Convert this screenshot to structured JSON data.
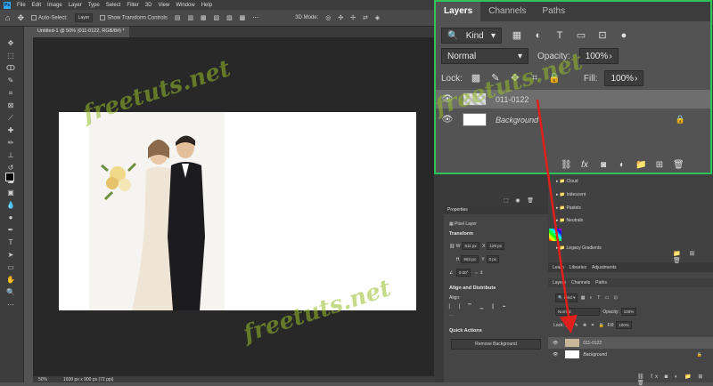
{
  "menubar": {
    "logo": "Ps",
    "items": [
      "File",
      "Edit",
      "Image",
      "Layer",
      "Type",
      "Select",
      "Filter",
      "3D",
      "View",
      "Window",
      "Help"
    ]
  },
  "options": {
    "auto_select": "Auto-Select:",
    "layer_select": "Layer",
    "transform_controls": "Show Transform Controls",
    "mode3d": "3D Mode:"
  },
  "document": {
    "tab": "Untitled-1 @ 50% (011-0122, RGB/8#) *",
    "zoom": "50%",
    "size": "1600 px x 900 px (72 ppi)"
  },
  "watermark": "freetuts.net",
  "layers_panel": {
    "tabs": [
      "Layers",
      "Channels",
      "Paths"
    ],
    "kind": "Kind",
    "blend": "Normal",
    "opacity_label": "Opacity:",
    "opacity": "100%",
    "lock_label": "Lock:",
    "fill_label": "Fill:",
    "fill": "100%",
    "layers": [
      {
        "name": "011-0122"
      },
      {
        "name": "Background"
      }
    ]
  },
  "gradients": {
    "groups": [
      "Cloud",
      "Iridescent",
      "Pastels",
      "Neutrals",
      "Legacy Gradients"
    ]
  },
  "properties": {
    "title": "Properties",
    "type": "Pixel Layer",
    "transform": "Transform",
    "w_label": "W",
    "w": "611 px",
    "x_label": "X",
    "x": "129 px",
    "h_label": "H",
    "h": "903 px",
    "y_label": "Y",
    "y": "0 px",
    "angle": "0.00°",
    "align_title": "Align and Distribute",
    "align": "Align:",
    "quick_actions": "Quick Actions",
    "remove_bg": "Remove Background"
  },
  "small_layers": {
    "tabs": [
      "Learn",
      "Libraries",
      "Adjustments"
    ],
    "subtabs": [
      "Layers",
      "Channels",
      "Paths"
    ],
    "kind": "Kind",
    "blend": "Normal",
    "opacity_label": "Opacity:",
    "opacity": "100%",
    "lock_label": "Lock:",
    "fill_label": "Fill:",
    "fill": "100%",
    "layers": [
      "011-0122",
      "Background"
    ]
  },
  "colors": {
    "highlight": "#2ec45a",
    "arrow": "#e0201c",
    "accent": "#31a8ff"
  }
}
